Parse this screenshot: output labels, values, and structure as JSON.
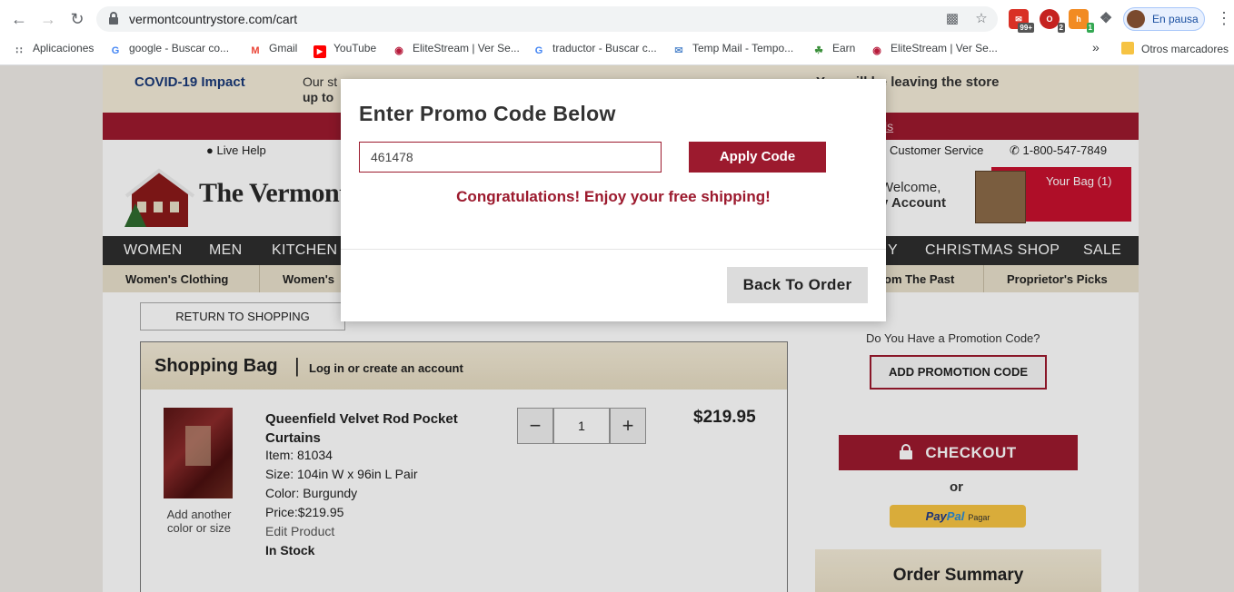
{
  "browser": {
    "url": "vermontcountrystore.com/cart",
    "profile_status": "En pausa",
    "ext_badges": [
      "99+",
      "2",
      "1"
    ],
    "bookmarks": [
      {
        "label": "Aplicaciones",
        "icon": "apps-grid-icon"
      },
      {
        "label": "google - Buscar co...",
        "icon": "google-icon"
      },
      {
        "label": "Gmail",
        "icon": "gmail-icon"
      },
      {
        "label": "YouTube",
        "icon": "youtube-icon"
      },
      {
        "label": "EliteStream | Ver Se...",
        "icon": "elitestream-icon"
      },
      {
        "label": "traductor - Buscar c...",
        "icon": "google-icon"
      },
      {
        "label": "Temp Mail - Tempo...",
        "icon": "mail-icon"
      },
      {
        "label": "Earn",
        "icon": "earn-icon"
      },
      {
        "label": "EliteStream | Ver Se...",
        "icon": "elitestream-icon"
      }
    ],
    "more_bookmarks": "»",
    "other_bookmarks": "Otros marcadores"
  },
  "site": {
    "covid_title": "COVID-19 Impact",
    "covid_text_line1": "Our st",
    "covid_text_line2": "up to",
    "covid_right": "Y      er will be leaving the store",
    "red_strip_link": "ls",
    "live_help": "Live Help",
    "customer_service": "Customer Service",
    "phone": "1-800-547-7849",
    "logo_text": "The Vermont C",
    "welcome": "Welcome,",
    "my_account": "y Account",
    "your_bag": "Your Bag (1)",
    "main_nav": [
      "WOMEN",
      "MEN",
      "KITCHEN",
      "Y",
      "CHRISTMAS SHOP",
      "SALE"
    ],
    "sub_nav": [
      "Women's Clothing",
      "Women's",
      "om The Past",
      "Proprietor's Picks"
    ],
    "return_to_shopping": "RETURN TO SHOPPING",
    "shopping_bag": {
      "title": "Shopping Bag",
      "pipe": "|",
      "login": "Log in",
      "or": "or",
      "create_account": "create an account",
      "item": {
        "name": "Queenfield Velvet Rod Pocket Curtains",
        "item_no": "Item: 81034",
        "size": "Size: 104in W x 96in L Pair",
        "color": "Color: Burgundy",
        "price_line": "Price:$219.95",
        "edit": "Edit Product",
        "stock": "In Stock",
        "add_another": "Add another color or size",
        "qty": "1",
        "qty_minus": "−",
        "qty_plus": "+",
        "price": "$219.95"
      }
    },
    "promo_question": "Do You Have a Promotion Code?",
    "add_promo": "ADD PROMOTION CODE",
    "checkout": "CHECKOUT",
    "or": "or",
    "paypal": {
      "pay": "Pay",
      "pal": "Pal",
      "pagar": "Pagar"
    },
    "order_summary": "Order Summary"
  },
  "modal": {
    "title": "Enter Promo Code Below",
    "promo_value": "461478",
    "apply": "Apply Code",
    "message": "Congratulations! Enjoy your free shipping!",
    "back": "Back To Order"
  },
  "colors": {
    "brand_red": "#9c1a2e",
    "nav_dark": "#2e2e2e",
    "covid_blue": "#1a3a78"
  }
}
